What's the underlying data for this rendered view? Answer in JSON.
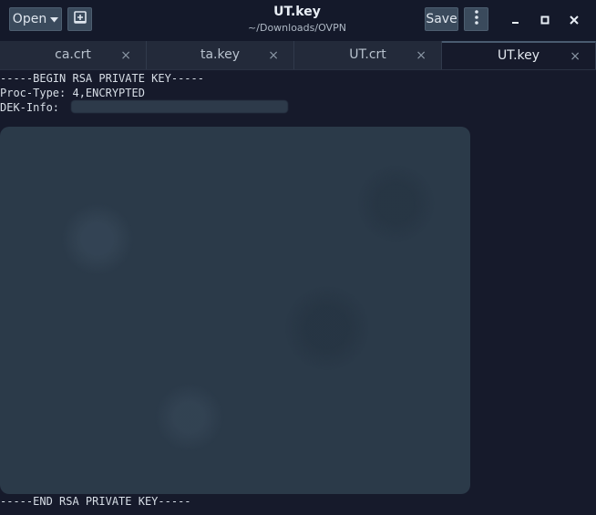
{
  "window": {
    "title": "UT.key",
    "subtitle": "~/Downloads/OVPN"
  },
  "header": {
    "open_label": "Open",
    "open_icon": "chevron-down-icon",
    "new_document_icon": "new-document-icon",
    "save_label": "Save",
    "menu_icon": "kebab-menu-icon",
    "minimize_icon": "minimize-icon",
    "maximize_icon": "maximize-icon",
    "close_icon": "close-icon"
  },
  "tabs": [
    {
      "label": "ca.crt",
      "close": "×",
      "active": false
    },
    {
      "label": "ta.key",
      "close": "×",
      "active": false
    },
    {
      "label": "UT.crt",
      "close": "×",
      "active": false
    },
    {
      "label": "UT.key",
      "close": "×",
      "active": true
    }
  ],
  "editor": {
    "line_begin": "-----BEGIN RSA PRIVATE KEY-----",
    "line_proc": "Proc-Type: 4,ENCRYPTED",
    "line_dek": "DEK-Info:",
    "line_end": "-----END RSA PRIVATE KEY-----"
  },
  "colors": {
    "background": "#161a2b",
    "button": "#3a4a5c",
    "redaction": "#2b3a49"
  }
}
